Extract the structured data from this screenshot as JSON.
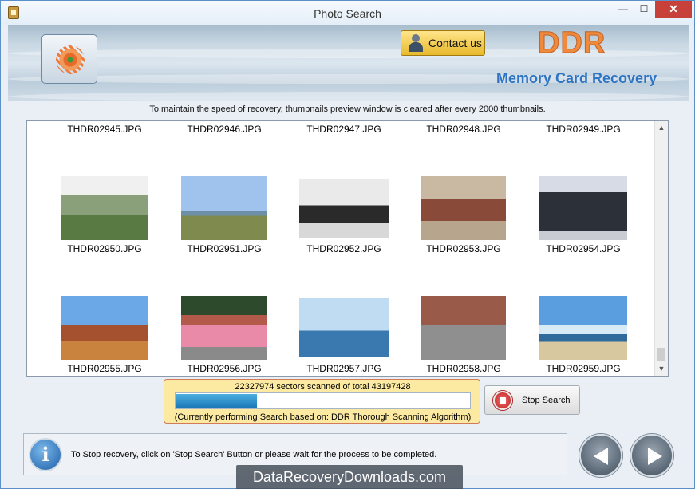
{
  "window": {
    "title": "Photo Search",
    "controls": {
      "minimize": "—",
      "maximize": "☐",
      "close": "✕"
    }
  },
  "banner": {
    "contact_label": "Contact us",
    "brand": "DDR",
    "product": "Memory Card Recovery"
  },
  "notice": "To maintain the speed of recovery, thumbnails preview window is cleared after every 2000 thumbnails.",
  "thumbnails": {
    "row1": [
      "THDR02945.JPG",
      "THDR02946.JPG",
      "THDR02947.JPG",
      "THDR02948.JPG",
      "THDR02949.JPG"
    ],
    "row2": [
      "THDR02950.JPG",
      "THDR02951.JPG",
      "THDR02952.JPG",
      "THDR02953.JPG",
      "THDR02954.JPG"
    ],
    "row3": [
      "THDR02955.JPG",
      "THDR02956.JPG",
      "THDR02957.JPG",
      "THDR02958.JPG",
      "THDR02959.JPG"
    ]
  },
  "scrollbar": {
    "up": "▲",
    "down": "▼"
  },
  "progress": {
    "sectors_text": "22327974 sectors scanned of total 43197428",
    "fraction": 0.2765,
    "algorithm_text": "(Currently performing Search based on:  DDR Thorough Scanning Algorithm)"
  },
  "stop_button": "Stop Search",
  "status": {
    "info_symbol": "i",
    "text": "To Stop recovery, click on 'Stop Search' Button or please wait for the process to be completed."
  },
  "watermark": "DataRecoveryDownloads.com",
  "colors": {
    "accent": "#2d74c4",
    "brand": "#f08a3a",
    "progress_fill": "#1c78b8",
    "progress_panel": "#fdeaa2"
  }
}
